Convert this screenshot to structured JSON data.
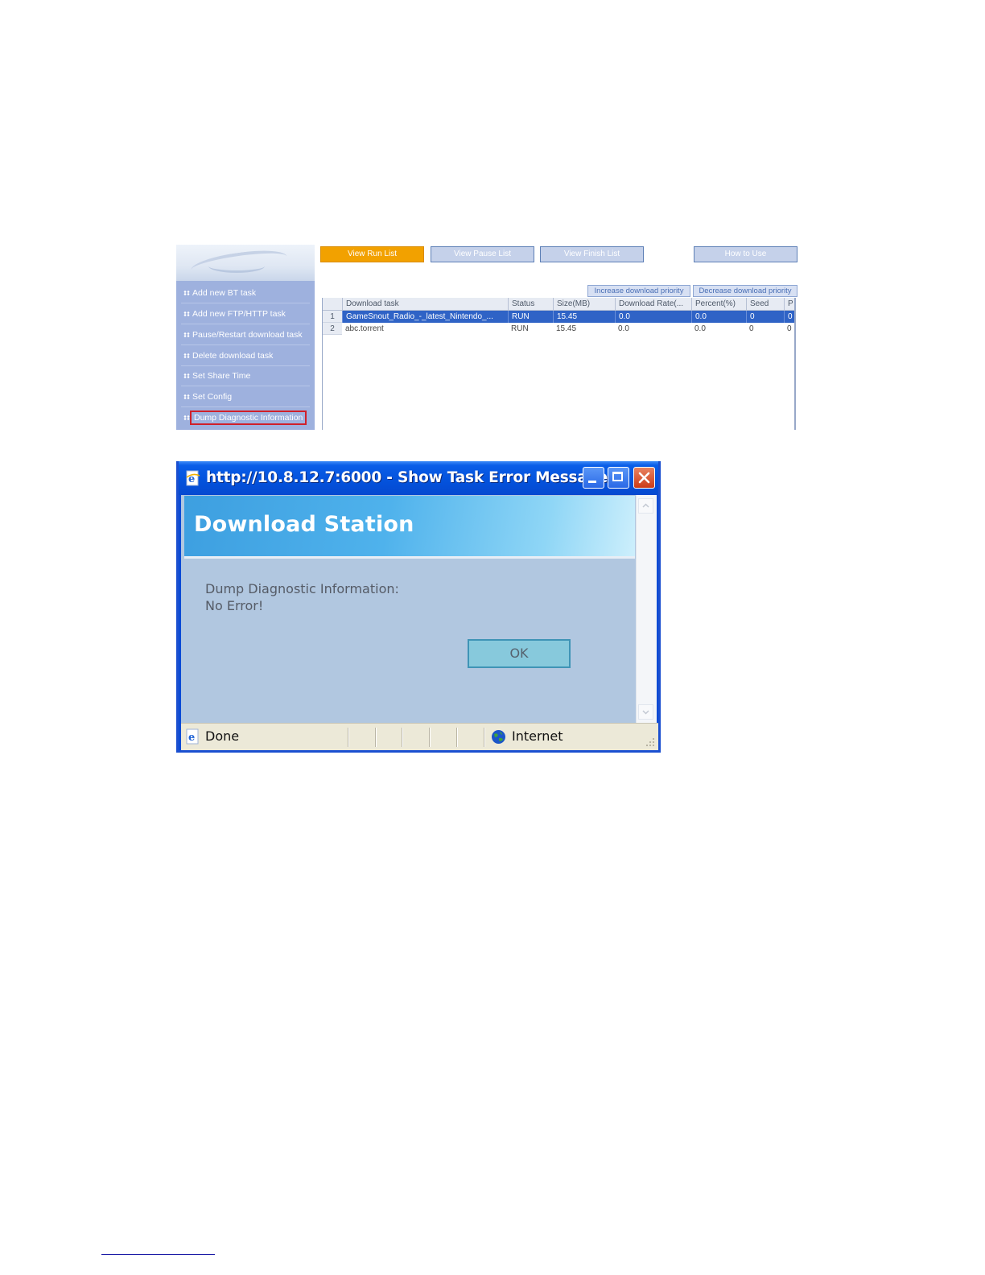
{
  "list_screen": {
    "top_tabs": [
      "View Run List",
      "View Pause List",
      "View Finish List",
      "How to Use"
    ],
    "active_tab": "View Run List",
    "sidebar_items": [
      "Add new BT task",
      "Add new FTP/HTTP task",
      "Pause/Restart download task",
      "Delete download task",
      "Set Share Time",
      "Set Config",
      "Dump Diagnostic Information"
    ],
    "highlighted_item": "Dump Diagnostic Information",
    "priority_buttons": [
      "Increase download priority",
      "Decrease download priority"
    ],
    "columns": [
      "Download task",
      "Status",
      "Size(MB)",
      "Download Rate(...",
      "Percent(%)",
      "Seed",
      "P"
    ],
    "rows": [
      {
        "num": "1",
        "task": "GameSnout_Radio_-_latest_Nintendo_...",
        "status": "RUN",
        "size": "15.45",
        "rate": "0.0",
        "percent": "0.0",
        "seed": "0",
        "p": "0",
        "selected": true
      },
      {
        "num": "2",
        "task": "abc.torrent",
        "status": "RUN",
        "size": "15.45",
        "rate": "0.0",
        "percent": "0.0",
        "seed": "0",
        "p": "0",
        "selected": false
      }
    ],
    "colors": {
      "active_tab": "#f2a100",
      "sidebar": "#9eb1de",
      "selected_row": "#2f63c6",
      "highlight_outline": "#d0202a"
    }
  },
  "popup": {
    "window_title": "http://10.8.12.7:6000 - Show Task Error Message ...",
    "banner_title": "Download Station",
    "message_line1": "Dump Diagnostic Information:",
    "message_line2": "No Error!",
    "ok_label": "OK",
    "status_left": "Done",
    "status_zone": "Internet",
    "icons": [
      "ie-page-icon",
      "minimize-icon",
      "maximize-icon",
      "close-icon",
      "scroll-up-arrow-icon",
      "scroll-down-arrow-icon",
      "ie-status-icon",
      "globe-icon",
      "resize-grip-icon"
    ],
    "colors": {
      "titlebar": "#0453dd",
      "content_bg": "#b1c7e0",
      "ok_button": "#87c9dc",
      "statusbar": "#ece9d8"
    }
  }
}
